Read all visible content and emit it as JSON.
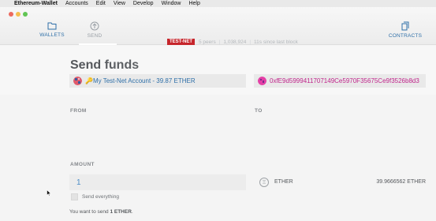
{
  "menubar": {
    "apple": "",
    "items": [
      "Ethereum-Wallet",
      "Accounts",
      "Edit",
      "View",
      "Develop",
      "Window",
      "Help"
    ]
  },
  "nav": {
    "wallets": "WALLETS",
    "send": "SEND",
    "contracts": "CONTRACTS",
    "wallets_icon": "folder-icon",
    "send_icon": "arrow-up-circle-icon",
    "contracts_icon": "contracts-pages-icon"
  },
  "status": {
    "network": "TEST-NET",
    "peers": "5 peers",
    "block": "1,038,924",
    "last_block": "11s since last block"
  },
  "page": {
    "title_bold": "Send",
    "title_rest": " funds"
  },
  "from": {
    "label": "FROM",
    "account": "🔑My Test-Net Account - 39.87 ETHER"
  },
  "to": {
    "label": "TO",
    "address": "0xfE9d5999411707149Ce5970F35675Ce9f3526b8d3"
  },
  "amount": {
    "label": "AMOUNT",
    "value": "1",
    "send_everything": "Send everything",
    "unit": "ETHER",
    "unit_icon": "Ξ",
    "balance": "39.9666562 ETHER",
    "summary_prefix": "You want to send ",
    "summary_value": "1 ETHER",
    "summary_suffix": "."
  },
  "colors": {
    "accent": "#2e6fa8",
    "testnet_badge": "#c6262c",
    "to_address": "#c0248b"
  }
}
